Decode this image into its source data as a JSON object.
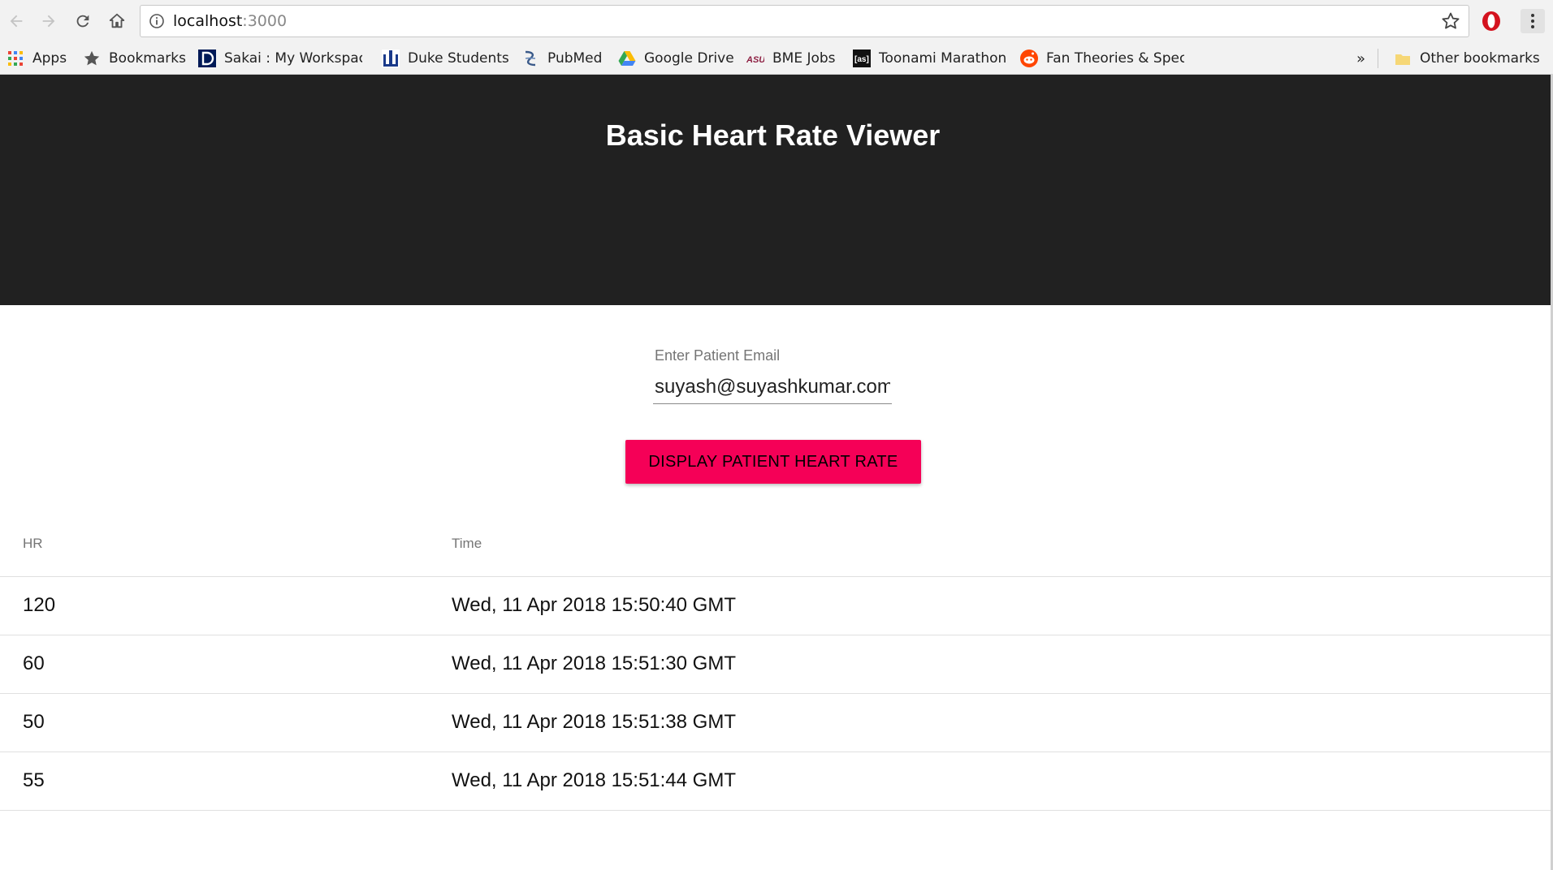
{
  "browser": {
    "url_host": "localhost",
    "url_port": ":3000",
    "bookmarks": [
      {
        "label": "Apps",
        "icon": "apps-grid-icon"
      },
      {
        "label": "Bookmarks",
        "icon": "star-icon"
      },
      {
        "label": "Sakai : My Workspace",
        "icon": "duke-d-icon"
      },
      {
        "label": "Duke Students",
        "icon": "duke-chapel-icon"
      },
      {
        "label": "PubMed",
        "icon": "pubmed-icon"
      },
      {
        "label": "Google Drive",
        "icon": "google-drive-icon"
      },
      {
        "label": "BME Jobs",
        "icon": "asu-icon"
      },
      {
        "label": "Toonami Marathon",
        "icon": "adult-swim-icon"
      },
      {
        "label": "Fan Theories & Specu",
        "icon": "reddit-icon"
      }
    ],
    "overflow_label": "»",
    "other_bookmarks": "Other bookmarks"
  },
  "app": {
    "title": "Basic Heart Rate Viewer",
    "email_label": "Enter Patient Email",
    "email_value": "suyash@suyashkumar.com",
    "button_label": "DISPLAY PATIENT HEART RATE",
    "accent_color": "#f50057",
    "header_color": "#212121"
  },
  "table": {
    "columns": [
      "HR",
      "Time"
    ],
    "rows": [
      {
        "hr": "120",
        "time": "Wed, 11 Apr 2018 15:50:40 GMT"
      },
      {
        "hr": "60",
        "time": "Wed, 11 Apr 2018 15:51:30 GMT"
      },
      {
        "hr": "50",
        "time": "Wed, 11 Apr 2018 15:51:38 GMT"
      },
      {
        "hr": "55",
        "time": "Wed, 11 Apr 2018 15:51:44 GMT"
      }
    ]
  }
}
